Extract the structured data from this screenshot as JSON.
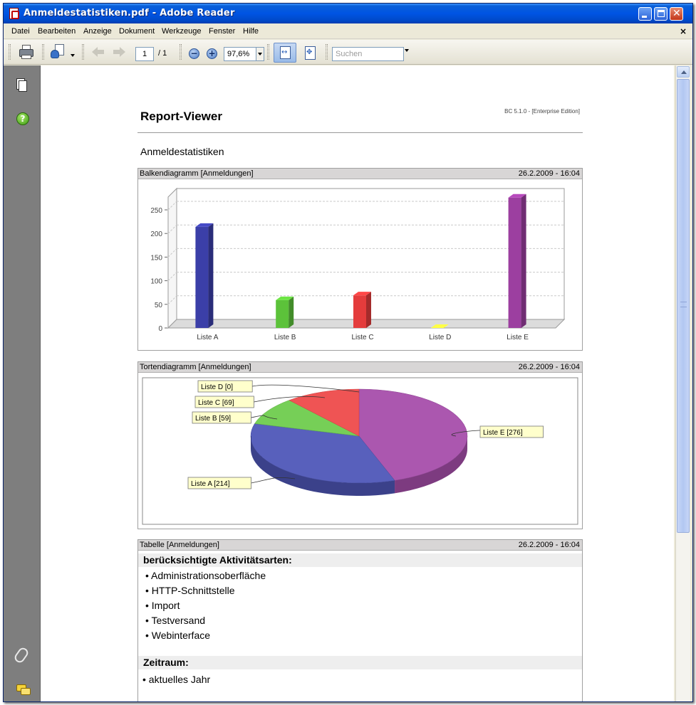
{
  "window": {
    "title": "Anmeldestatistiken.pdf - Adobe Reader"
  },
  "menu": [
    "Datei",
    "Bearbeiten",
    "Anzeige",
    "Dokument",
    "Werkzeuge",
    "Fenster",
    "Hilfe"
  ],
  "menu_close": "×",
  "toolbar": {
    "page_current": "1",
    "page_total": "/ 1",
    "zoom": "97,6%",
    "search_placeholder": "Suchen"
  },
  "icons": {
    "print": "printer-icon",
    "collaborate": "collaborate-icon",
    "prev": "arrow-left-icon",
    "next": "arrow-right-icon",
    "zoom_out": "zoom-out-icon",
    "zoom_in": "zoom-in-icon",
    "fit_width": "fit-width-icon",
    "fit_page": "fit-page-icon",
    "pages": "pages-icon",
    "help": "help-icon",
    "attachments": "paperclip-icon",
    "comments": "comment-icon"
  },
  "report": {
    "title": "Report-Viewer",
    "version": "BC 5.1.0 - [Enterprise Edition]",
    "subtitle": "Anmeldestatistiken"
  },
  "bar_panel": {
    "title": "Balkendiagramm [Anmeldungen]",
    "date": "26.2.2009 - 16:04"
  },
  "pie_panel": {
    "title": "Tortendiagramm [Anmeldungen]",
    "date": "26.2.2009 - 16:04"
  },
  "table_panel": {
    "title": "Tabelle [Anmeldungen]",
    "date": "26.2.2009 - 16:04",
    "activities_heading": "berücksichtigte Aktivitätsarten:",
    "activities": [
      "• Administrationsoberfläche",
      "• HTTP-Schnittstelle",
      "• Import",
      "• Testversand",
      "• Webinterface"
    ],
    "period_heading": "Zeitraum:",
    "period": "• aktuelles Jahr"
  },
  "chart_data": [
    {
      "type": "bar",
      "categories": [
        "Liste A",
        "Liste B",
        "Liste C",
        "Liste D",
        "Liste E"
      ],
      "values": [
        214,
        59,
        69,
        0,
        276
      ],
      "colors": [
        "#3b3fa8",
        "#5cc23a",
        "#e43c3c",
        "#e8e03a",
        "#9c3fa0"
      ],
      "yticks": [
        0,
        50,
        100,
        150,
        200,
        250
      ],
      "ylim": [
        0,
        300
      ],
      "grid": true
    },
    {
      "type": "pie",
      "labels": [
        "Liste A [214]",
        "Liste B [59]",
        "Liste C [69]",
        "Liste D [0]",
        "Liste E [276]"
      ],
      "values": [
        214,
        59,
        69,
        0,
        276
      ],
      "colors": [
        "#4f57b8",
        "#6fcc4e",
        "#ee4b4b",
        "#e8e03a",
        "#a64eab"
      ]
    }
  ]
}
